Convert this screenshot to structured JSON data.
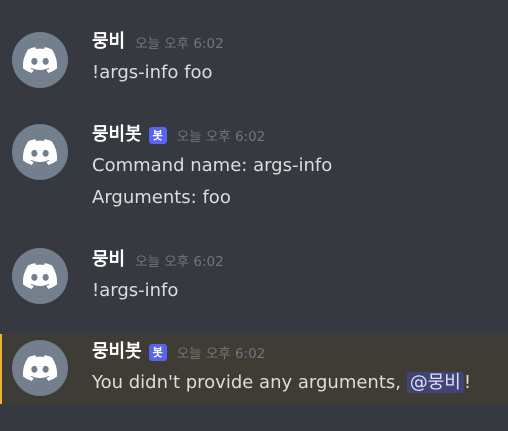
{
  "messages": [
    {
      "username": "뭉비",
      "timestamp": "오늘 오후 6:02",
      "lines": [
        "!args-info foo"
      ]
    },
    {
      "username": "뭉비봇",
      "bot_tag": "봇",
      "timestamp": "오늘 오후 6:02",
      "lines": [
        "Command name: args-info",
        "Arguments: foo"
      ]
    },
    {
      "username": "뭉비",
      "timestamp": "오늘 오후 6:02",
      "lines": [
        "!args-info"
      ]
    },
    {
      "username": "뭉비봇",
      "bot_tag": "봇",
      "timestamp": "오늘 오후 6:02",
      "text_before": "You didn't provide any arguments,",
      "mention": "@뭉비",
      "text_after": "!"
    }
  ],
  "colors": {
    "background": "#36393f",
    "highlight_background": "#3f3b35",
    "bot_tag": "#5865f2",
    "avatar": "#747f8d",
    "mention_background": "#414475"
  },
  "icons": {
    "avatar": "discord-logo-icon"
  }
}
